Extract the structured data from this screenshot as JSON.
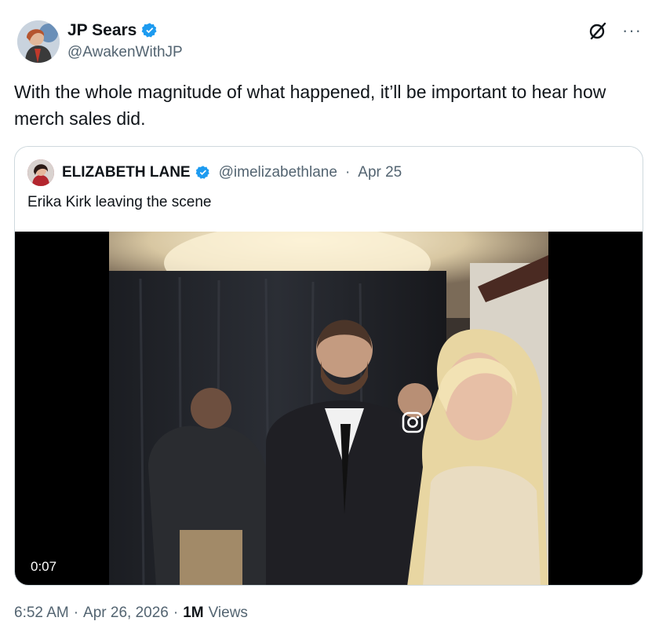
{
  "author": {
    "name": "JP Sears",
    "handle": "@AwakenWithJP",
    "verified_icon": "verified-badge-icon"
  },
  "toolbar": {
    "grok_icon": "grok-icon",
    "more_label": "···"
  },
  "tweet": {
    "text": "With the whole magnitude of what happened, it’ll be important to hear how merch sales did."
  },
  "quoted": {
    "name": "ELIZABETH LANE",
    "handle": "@imelizabethlane",
    "separator": "·",
    "date": "Apr 25",
    "text": "Erika Kirk leaving the scene",
    "video": {
      "duration": "0:07",
      "watermark_icon": "instagram-icon"
    }
  },
  "meta": {
    "time": "6:52 AM",
    "sep1": "·",
    "date": "Apr 26, 2026",
    "sep2": "·",
    "views_count": "1M",
    "views_label": "Views"
  },
  "colors": {
    "verified": "#1d9bf0",
    "secondary_text": "#536471",
    "border": "#cfd9de"
  }
}
